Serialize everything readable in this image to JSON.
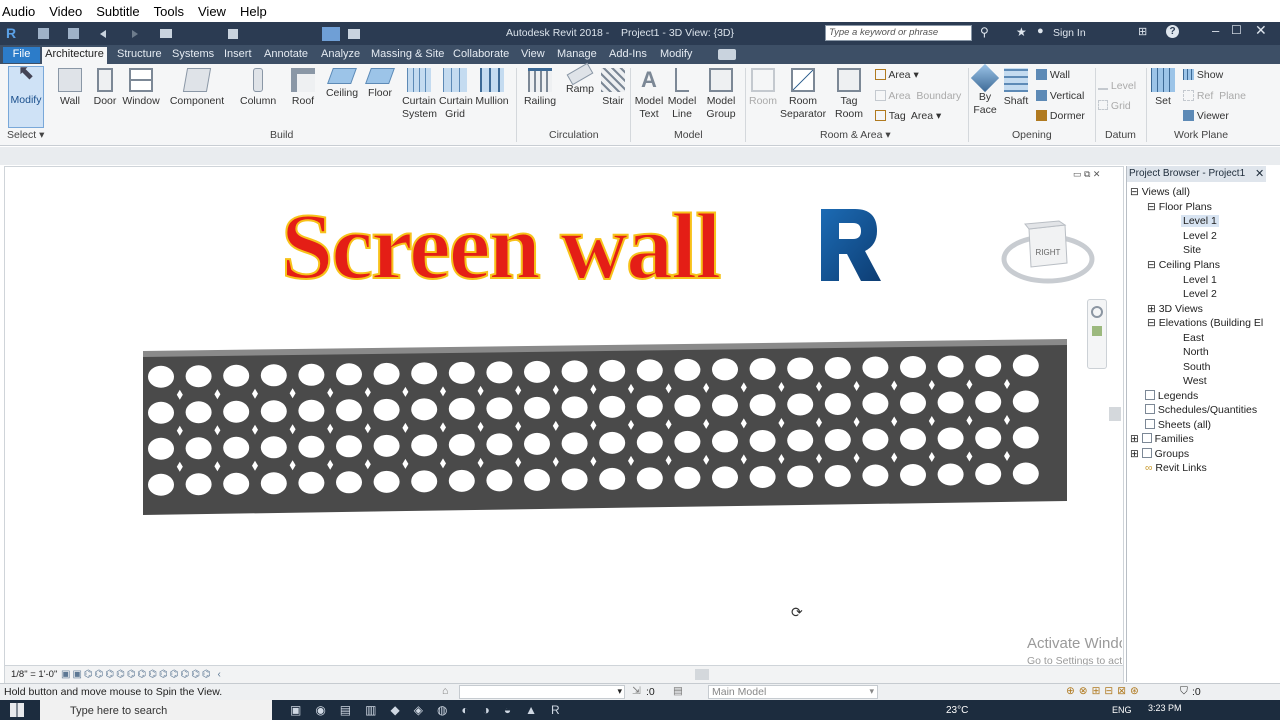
{
  "player_menu": [
    "Audio",
    "Video",
    "Subtitle",
    "Tools",
    "View",
    "Help"
  ],
  "window": {
    "title": "Autodesk Revit 2018 -    Project1 - 3D View: {3D}",
    "search_placeholder": "Type a keyword or phrase",
    "sign_in": "Sign In"
  },
  "tabs": [
    "File",
    "Architecture",
    "Structure",
    "Systems",
    "Insert",
    "Annotate",
    "Analyze",
    "Massing & Site",
    "Collaborate",
    "View",
    "Manage",
    "Add-Ins",
    "Modify"
  ],
  "tools": {
    "modify": "Modify",
    "wall": "Wall",
    "door": "Door",
    "window": "Window",
    "component": "Component",
    "column": "Column",
    "roof": "Roof",
    "ceiling": "Ceiling",
    "floor": "Floor",
    "curtain_system": "Curtain System",
    "curtain_grid": "Curtain Grid",
    "mullion": "Mullion",
    "railing": "Railing",
    "ramp": "Ramp",
    "stair": "Stair",
    "model_text": "Model Text",
    "model_line": "Model Line",
    "model_group": "Model Group",
    "room": "Room",
    "room_separator": "Room Separator",
    "tag_room": "Tag Room",
    "area": "Area",
    "area_boundary": "Area  Boundary",
    "tag_area": "Tag  Area",
    "by_face": "By Face",
    "shaft": "Shaft",
    "wall_opening": "Wall",
    "vertical": "Vertical",
    "dormer": "Dormer",
    "level": "Level",
    "grid": "Grid",
    "set": "Set",
    "show": "Show",
    "ref_plane": "Ref  Plane",
    "viewer": "Viewer"
  },
  "panels": {
    "select": "Select",
    "build": "Build",
    "circulation": "Circulation",
    "model": "Model",
    "room_area": "Room & Area",
    "opening": "Opening",
    "datum": "Datum",
    "work_plane": "Work Plane"
  },
  "overlay": {
    "title": "Screen wall",
    "logo": "R"
  },
  "viewcube": {
    "face": "RIGHT"
  },
  "project_browser": {
    "title": "Project Browser - Project1",
    "views": "Views (all)",
    "floor_plans": "Floor Plans",
    "fp_level1": "Level 1",
    "fp_level2": "Level 2",
    "site": "Site",
    "ceiling_plans": "Ceiling Plans",
    "cp_level1": "Level 1",
    "cp_level2": "Level 2",
    "views_3d": "3D Views",
    "elevations": "Elevations (Building El",
    "east": "East",
    "north": "North",
    "south": "South",
    "west": "West",
    "legends": "Legends",
    "schedules": "Schedules/Quantities",
    "sheets": "Sheets (all)",
    "families": "Families",
    "groups": "Groups",
    "revit_links": "Revit Links"
  },
  "view_control": {
    "scale": "1/8\" = 1'-0\""
  },
  "watermark": {
    "line1": "Activate Windows",
    "line2": "Go to Settings to activate Windows."
  },
  "status": {
    "hint": "Hold button and move mouse to Spin the View.",
    "count1": ":0",
    "model": "Main Model",
    "count2": ":0"
  },
  "taskbar": {
    "search": "Type here to search",
    "temp": "23°C",
    "time": "3:23 PM",
    "lang": "ENG"
  },
  "colors": {
    "title_red": "#e41e16",
    "title_outline": "#f7c21a",
    "wall": "#4a4a4a",
    "accent": "#2e6fb0"
  }
}
